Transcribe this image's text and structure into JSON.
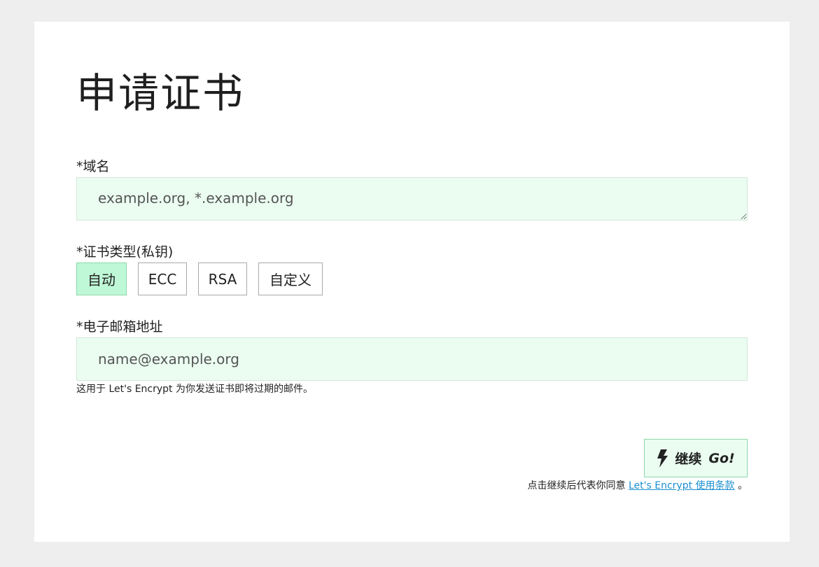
{
  "page": {
    "title": "申请证书"
  },
  "domain": {
    "label": "*域名",
    "placeholder": "example.org, *.example.org",
    "value": ""
  },
  "cert_type": {
    "label": "*证书类型(私钥)",
    "options": [
      "自动",
      "ECC",
      "RSA",
      "自定义"
    ],
    "selected": "自动"
  },
  "email": {
    "label": "*电子邮箱地址",
    "placeholder": "name@example.org",
    "value": "",
    "hint": "这用于 Let's Encrypt 为你发送证书即将过期的邮件。"
  },
  "submit": {
    "icon": "bolt-icon",
    "label": "继续",
    "go": "Go!"
  },
  "terms": {
    "prefix": "点击继续后代表你同意",
    "link_text": "Let's Encrypt 使用条款",
    "suffix": "。"
  },
  "colors": {
    "accent_bg": "#ebfdf1",
    "active_option": "#bff8d6",
    "link": "#1a8fd0"
  }
}
